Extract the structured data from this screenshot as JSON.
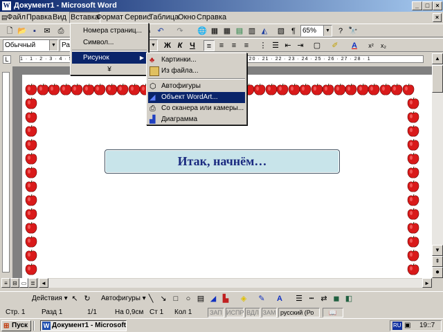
{
  "window": {
    "title": "Документ1 - Microsoft Word",
    "app_icon": "W",
    "min": "_",
    "max": "□",
    "close": "×"
  },
  "menubar": [
    "Файл",
    "Правка",
    "Вид",
    "Вставка",
    "Формат",
    "Сервис",
    "Таблица",
    "Окно",
    "Справка"
  ],
  "toolbar": {
    "zoom": "65%",
    "style": "Обычный",
    "font": "Ра",
    "bold": "Ж",
    "italic": "К",
    "underline": "Ч",
    "pilcrow": "¶",
    "help": "?"
  },
  "ruler": {
    "marks": "1 · 1 · 2 · 3 · 4 · 5 · 6 · 7 · 8 · 9 · 10 · 11 · 12 · 13 · 14 · 15 · 16 · 17 · 18 · 19 · 20 · 21 · 22 · 23 · 24 · 25 · 26 · 27 · 28 · 1"
  },
  "insert_menu": {
    "items": [
      "Номера страниц...",
      "Символ...",
      "Рисунок"
    ],
    "more": "¥"
  },
  "picture_menu": {
    "items": [
      "Картинки...",
      "Из файла...",
      "Автофигуры",
      "Объект WordArt...",
      "Со сканера или камеры...",
      "Диаграмма"
    ],
    "selected_index": 3
  },
  "wordart": {
    "text": "Итак, начнём…"
  },
  "drawbar": {
    "actions": "Действия",
    "autoshapes": "Автофигуры"
  },
  "status": {
    "page": "Стр. 1",
    "section": "Разд 1",
    "pages": "1/1",
    "at": "На 0,9см",
    "line": "Ст 1",
    "col": "Кол 1",
    "rec": "ЗАП",
    "trk": "ИСПР",
    "ext": "ВДЛ",
    "ovr": "ЗАМ",
    "lang": "русский (Ро"
  },
  "taskbar": {
    "start": "Пуск",
    "task": "Документ1 - Microsoft...",
    "lang": "RU",
    "time": "19::7"
  },
  "colors": {
    "title_start": "#0a246a",
    "title_end": "#a6caf0",
    "highlight": "#0a246a",
    "apple": "#d91a1a",
    "wordart_fill": "#c8e4ea",
    "wordart_text": "#1a2a80"
  }
}
